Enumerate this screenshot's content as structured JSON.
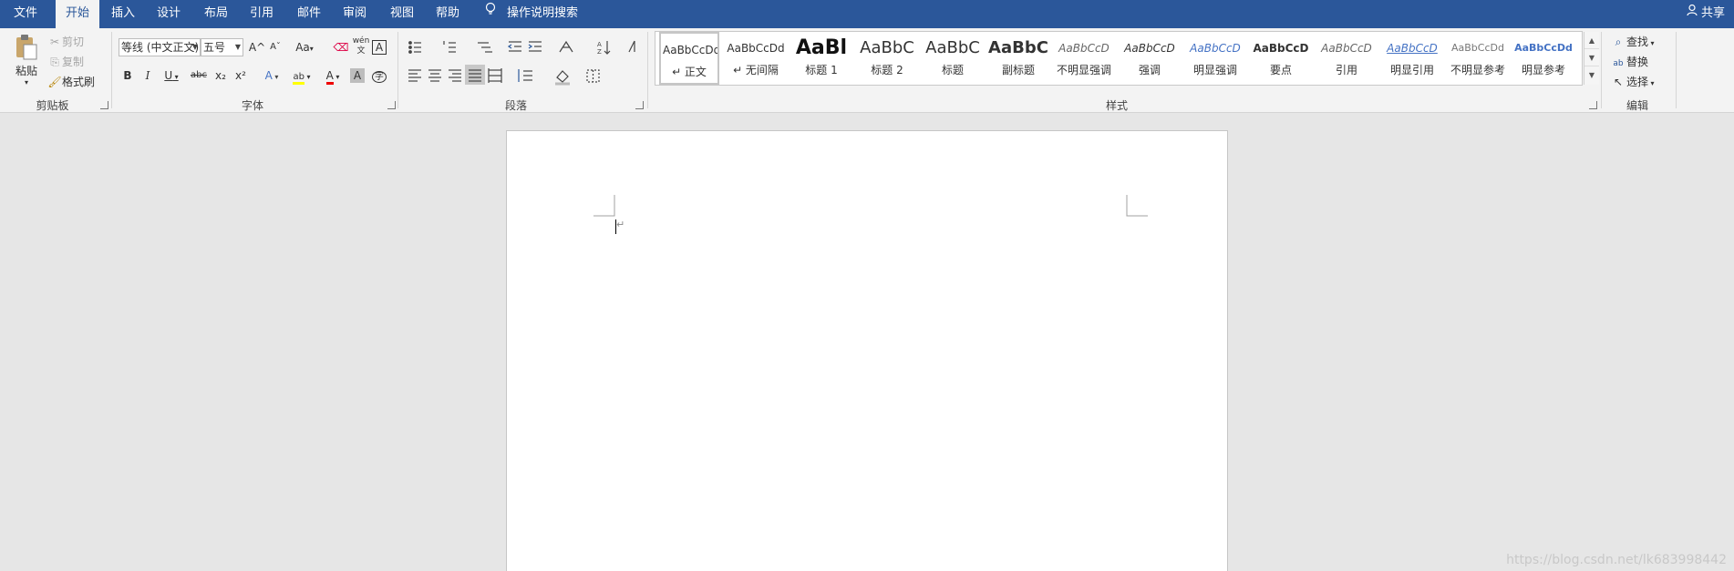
{
  "tabs": {
    "items": [
      {
        "label": "文件"
      },
      {
        "label": "开始"
      },
      {
        "label": "插入"
      },
      {
        "label": "设计"
      },
      {
        "label": "布局"
      },
      {
        "label": "引用"
      },
      {
        "label": "邮件"
      },
      {
        "label": "审阅"
      },
      {
        "label": "视图"
      },
      {
        "label": "帮助"
      }
    ],
    "active": "开始",
    "tell_me": "操作说明搜索",
    "share": "共享"
  },
  "clipboard": {
    "paste": "粘贴",
    "cut": "剪切",
    "copy": "复制",
    "format_painter": "格式刷",
    "label": "剪贴板"
  },
  "font": {
    "name": "等线 (中文正文)",
    "size": "五号",
    "label": "字体",
    "bold": "B",
    "italic": "I",
    "underline": "U",
    "strike": "abc",
    "subscript": "x₂",
    "superscript": "x²",
    "grow": "A^",
    "shrink": "Aˇ",
    "change_case": "Aa",
    "phonetic": "wén 文",
    "char_border": "A",
    "text_effect": "A",
    "highlight": "ab",
    "font_color": "A",
    "char_shading": "A",
    "enclose": "字"
  },
  "paragraph": {
    "label": "段落"
  },
  "styles": {
    "label": "样式",
    "items": [
      {
        "preview": "AaBbCcDd",
        "name": "↵ 正文"
      },
      {
        "preview": "AaBbCcDd",
        "name": "↵ 无间隔"
      },
      {
        "preview": "AaBl",
        "name": "标题 1"
      },
      {
        "preview": "AaBbC",
        "name": "标题 2"
      },
      {
        "preview": "AaBbC",
        "name": "标题"
      },
      {
        "preview": "AaBbC",
        "name": "副标题"
      },
      {
        "preview": "AaBbCcD",
        "name": "不明显强调"
      },
      {
        "preview": "AaBbCcD",
        "name": "强调"
      },
      {
        "preview": "AaBbCcD",
        "name": "明显强调"
      },
      {
        "preview": "AaBbCcD",
        "name": "要点"
      },
      {
        "preview": "AaBbCcD",
        "name": "引用"
      },
      {
        "preview": "AaBbCcD",
        "name": "明显引用"
      },
      {
        "preview": "AaBbCcDd",
        "name": "不明显参考"
      },
      {
        "preview": "AaBbCcDd",
        "name": "明显参考"
      }
    ]
  },
  "editing": {
    "find": "查找",
    "replace": "替换",
    "select": "选择",
    "label": "编辑"
  },
  "document": {
    "cursor_mark": "↵"
  },
  "watermark": "https://blog.csdn.net/lk683998442",
  "colors": {
    "accent": "#2b579a",
    "ribbon": "#f3f3f3",
    "workspace": "#e6e6e6"
  }
}
